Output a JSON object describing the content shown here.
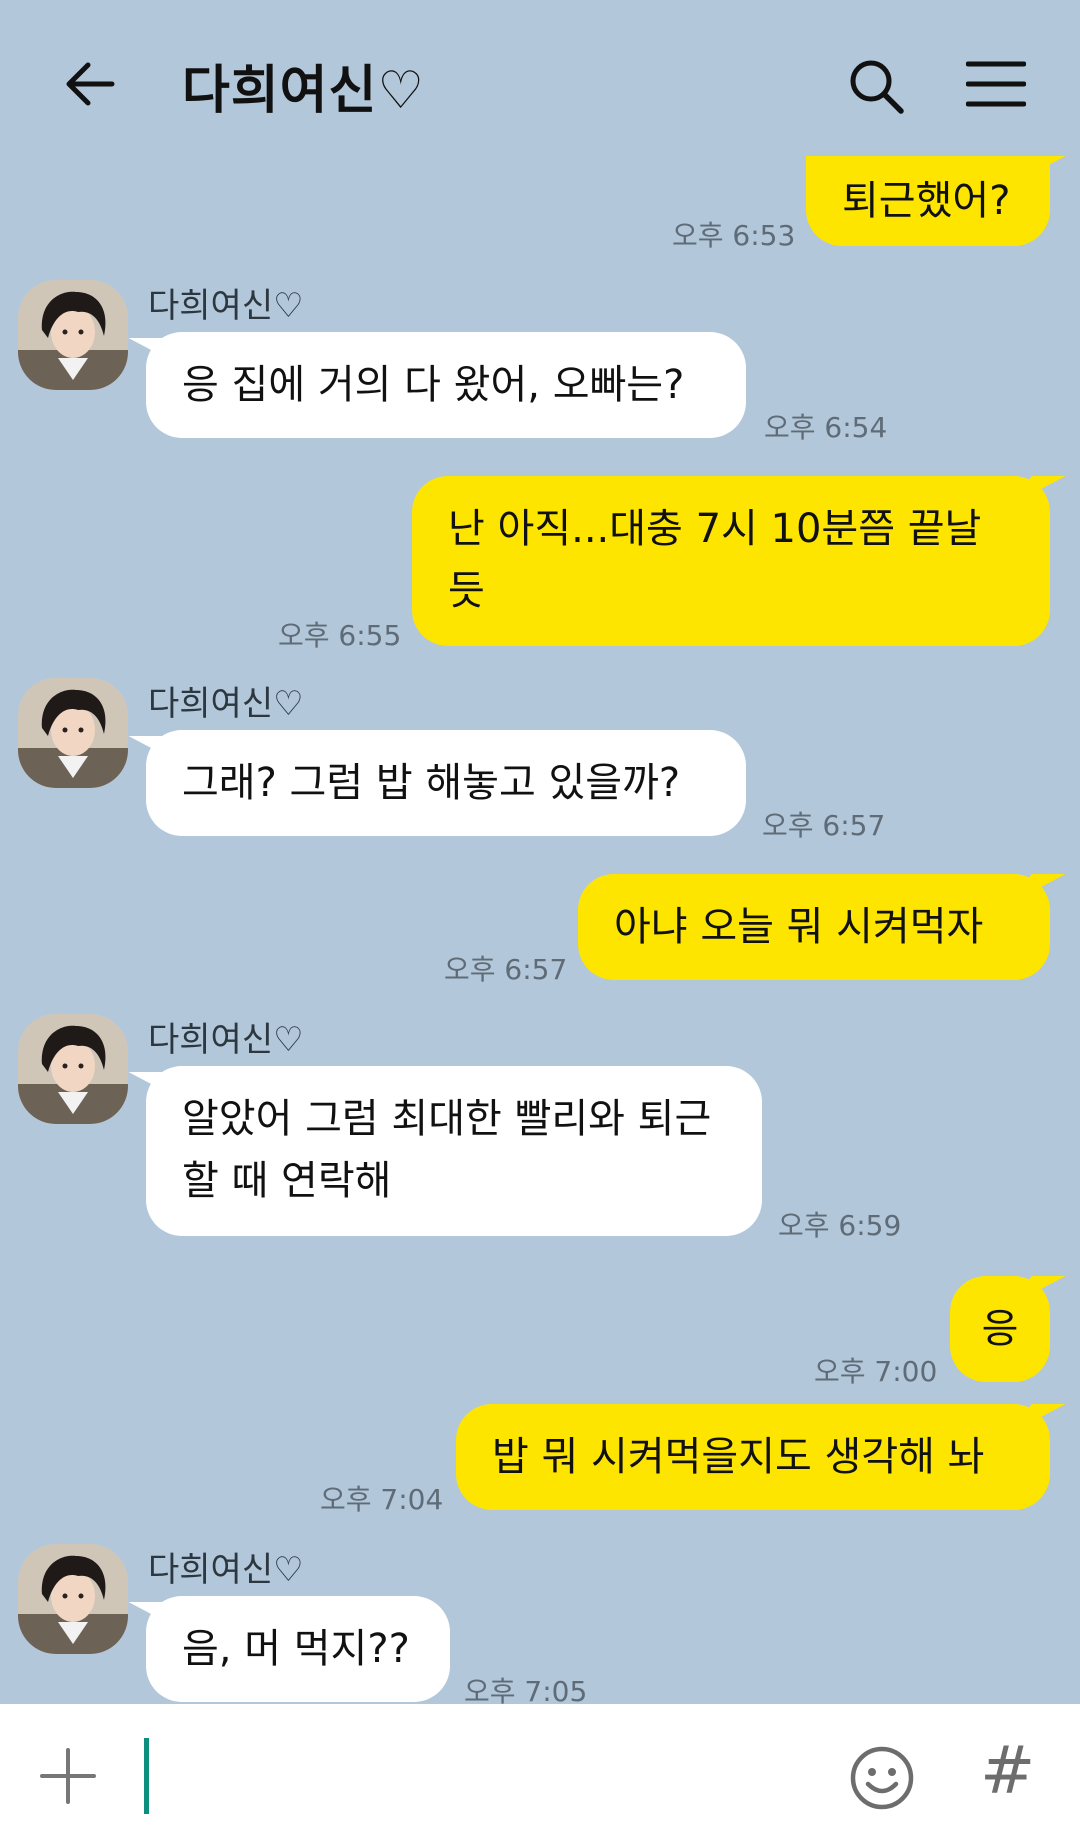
{
  "header": {
    "title": "다희여신♡"
  },
  "messages": [
    {
      "side": "me",
      "text": "퇴근했어?",
      "time": "오후 6:53"
    },
    {
      "side": "other",
      "sender": "다희여신♡",
      "text": "응 집에 거의 다 왔어, 오빠는?",
      "time": "오후 6:54"
    },
    {
      "side": "me",
      "text": "난 아직...대충 7시 10분쯤 끝날 듯",
      "time": "오후 6:55"
    },
    {
      "side": "other",
      "sender": "다희여신♡",
      "text": "그래? 그럼 밥 해놓고 있을까?",
      "time": "오후 6:57"
    },
    {
      "side": "me",
      "text": "아냐 오늘 뭐 시켜먹자",
      "time": "오후 6:57"
    },
    {
      "side": "other",
      "sender": "다희여신♡",
      "text": "알았어 그럼 최대한 빨리와 퇴근할 때 연락해",
      "time": "오후 6:59"
    },
    {
      "side": "me",
      "text": "응",
      "time": "오후 7:00"
    },
    {
      "side": "me",
      "text": "밥 뭐 시켜먹을지도 생각해 놔",
      "time": "오후 7:04"
    },
    {
      "side": "other",
      "sender": "다희여신♡",
      "text": "음, 머 먹지??",
      "time": "오후 7:05"
    }
  ],
  "icons": {
    "back": "arrow-left",
    "search": "magnifier",
    "menu": "hamburger",
    "add": "plus",
    "emoji": "smiley",
    "hashtag": "#"
  },
  "colors": {
    "background": "#b2c7da",
    "my_bubble": "#fee500",
    "other_bubble": "#ffffff",
    "cursor": "#0d8f80"
  }
}
